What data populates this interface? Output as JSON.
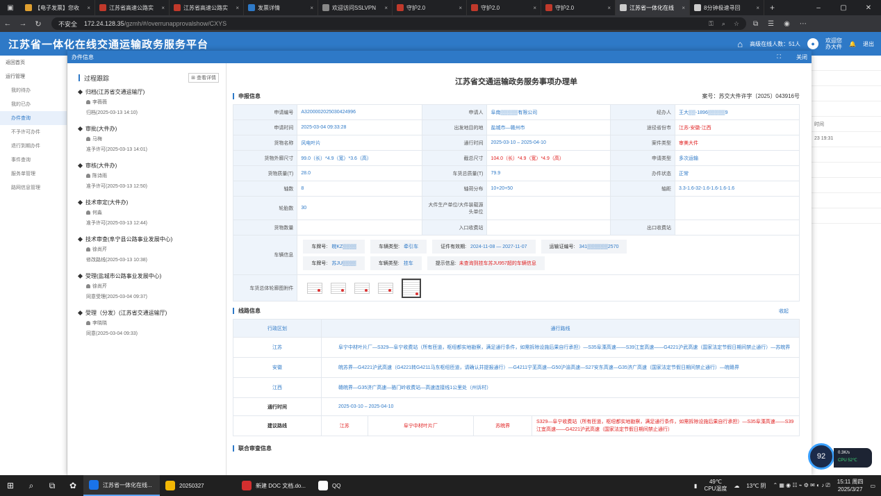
{
  "browser": {
    "tabs": [
      {
        "label": "【电子发票】您收",
        "color": "#e0a030"
      },
      {
        "label": "江苏省高速公路实",
        "color": "#c0392b"
      },
      {
        "label": "江苏省高速公路实",
        "color": "#c0392b"
      },
      {
        "label": "发票详情",
        "color": "#2e79c7"
      },
      {
        "label": "欢迎访问SSLVPN",
        "color": "#888888"
      },
      {
        "label": "守护2.0",
        "color": "#c0392b"
      },
      {
        "label": "守护2.0",
        "color": "#c0392b"
      },
      {
        "label": "守护2.0",
        "color": "#c0392b"
      },
      {
        "label": "江苏省一体化在线",
        "color": "#cccccc",
        "active": true
      },
      {
        "label": "8分钟极速寻回",
        "color": "#cccccc"
      }
    ],
    "insecure_label": "不安全",
    "url_host": "172.24.128.35",
    "url_path": "/gzmh/#/overrunapprovalshow/CXYS"
  },
  "app": {
    "title": "江苏省一体化在线交通运输政务服务平台",
    "online_users": "高级在线人数：51人",
    "welcome": "欢迎您",
    "username": "办大件",
    "logout": "退出"
  },
  "leftnav": [
    {
      "label": "返回首页",
      "sub": false
    },
    {
      "label": "运行管理",
      "sub": false
    },
    {
      "label": "我的待办",
      "sub": true
    },
    {
      "label": "我的已办",
      "sub": true
    },
    {
      "label": "办件查询",
      "sub": true,
      "selected": true
    },
    {
      "label": "不予许可办件",
      "sub": true
    },
    {
      "label": "退行到期办件",
      "sub": true
    },
    {
      "label": "事件查询",
      "sub": true
    },
    {
      "label": "服务单管理",
      "sub": true
    },
    {
      "label": "路网信息管理",
      "sub": true
    }
  ],
  "bg_right": [
    "",
    "",
    "",
    "",
    "时间",
    "23 19:31",
    "",
    "",
    "",
    "",
    ""
  ],
  "modal": {
    "title": "办件信息",
    "fullscreen": "⛶",
    "close": "关闭"
  },
  "track": {
    "title": "过程跟踪",
    "detail_btn": "查看详情",
    "steps": [
      {
        "title": "归档(江苏省交通运输厅)",
        "person": "李薇薇",
        "time": "归档(2025-03-13 14:10)"
      },
      {
        "title": "审批(大件办)",
        "person": "马梅",
        "time": "准予许可(2025-03-13 14:01)"
      },
      {
        "title": "审核(大件办)",
        "person": "陈诗雨",
        "time": "准予许可(2025-03-13 12:50)"
      },
      {
        "title": "技术审定(大件办)",
        "person": "何淼",
        "time": "准予许可(2025-03-13 12:44)"
      },
      {
        "title": "技术审查(阜宁县公路事业发展中心)",
        "person": "徐尚芹",
        "time": "修改路线(2025-03-13 10:38)"
      },
      {
        "title": "受理(盐城市公路事业发展中心)",
        "person": "徐尚芹",
        "time": "同意受理(2025-03-04 09:37)"
      },
      {
        "title": "受理（分发）(江苏省交通运输厅)",
        "person": "李晓晓",
        "time": "同意(2025-03-04 09:33)"
      }
    ]
  },
  "form": {
    "title": "江苏省交通运输政务服务事项办理单",
    "section1": "申报信息",
    "case_no": "案号：苏交大件许字〔2025〕043916号",
    "rows": [
      [
        [
          "申请编号",
          "A3200002025030424996",
          "v"
        ],
        [
          "申请人",
          "阜南▒▒▒▒▒有限公司",
          "v"
        ],
        [
          "经办人",
          "王大▒▒-1896▒▒▒▒▒9",
          "v"
        ]
      ],
      [
        [
          "申请时间",
          "2025-03-04 09:33:28",
          "v"
        ],
        [
          "出发地目的地",
          "盐城市—赣州市",
          "v"
        ],
        [
          "途径省份市",
          "江苏-安徽-江西",
          "red"
        ]
      ],
      [
        [
          "货物名称",
          "风电叶片",
          "v"
        ],
        [
          "通行时间",
          "2025-03-10 – 2025-04-10",
          "v"
        ],
        [
          "案件类型",
          "审美大件",
          "red"
        ]
      ],
      [
        [
          "货物外廓尺寸",
          "99.0（长）*4.9（宽）*3.6（高）",
          "v"
        ],
        [
          "截总尺寸",
          "104.0（长）*4.9（宽）*4.9（高）",
          "red"
        ],
        [
          "申请类型",
          "多次运输",
          "v"
        ]
      ],
      [
        [
          "货物质量(T)",
          "28.0",
          "v"
        ],
        [
          "车货总质量(T)",
          "79.9",
          "v"
        ],
        [
          "办件状态",
          "正常",
          "v"
        ]
      ],
      [
        [
          "轴数",
          "8",
          "v"
        ],
        [
          "轴荷分布",
          "10+20+50",
          "v"
        ],
        [
          "轴距",
          "3.3-1.6-32-1.6-1.6-1.6-1.6",
          "v"
        ]
      ],
      [
        [
          "轮胎数",
          "30",
          "v"
        ],
        [
          "大件生产单位/大件装载源头单位",
          "",
          "v"
        ],
        [
          "",
          "",
          "v"
        ]
      ],
      [
        [
          "货物数量",
          "",
          "v"
        ],
        [
          "入口收费站",
          "",
          "v"
        ],
        [
          "出口收费站",
          "",
          "v"
        ]
      ]
    ],
    "vehicle_label": "车辆信息",
    "vehicle_row1": [
      {
        "k": "车牌号:",
        "v": "皖KZ▒▒▒▒",
        "cls": "vv"
      },
      {
        "k": "车辆类型:",
        "v": "牵引车",
        "cls": "vv"
      },
      {
        "k": "证件有效期:",
        "v": "2024-11-08 — 2027-11-07",
        "cls": "vv"
      },
      {
        "k": "运输证编号:",
        "v": "341▒▒▒▒▒▒2570",
        "cls": "vv"
      }
    ],
    "vehicle_row2": [
      {
        "k": "车牌号:",
        "v": "苏JU▒▒▒▒",
        "cls": "vv"
      },
      {
        "k": "车辆类型:",
        "v": "挂车",
        "cls": "vv"
      },
      {
        "k": "提示信息:",
        "v": "未查询到挂车苏JU957超的车辆信息",
        "cls": "vr"
      }
    ],
    "attach_label": "车货总体轮廓图附件",
    "section2": "线路信息",
    "collapse": "收起",
    "route_head": [
      "行政区划",
      "通行路线"
    ],
    "routes": [
      {
        "region": "江苏",
        "route": "阜宁中材叶片厂—S329—阜宁收费站（所有匝道，枢纽都实地勘察，满足通行条件，如需拆除设施后果自行承担）—S35阜溧高速——S39江宜高速——G4221沪武高速（国家法定节假日期间禁止通行）—苏皖界"
      },
      {
        "region": "安徽",
        "route": "皖苏界—G4221沪武高速（G4221转G4211马东枢纽匝道，请确认并提报通行）—G4211宁芜高速—G50沪渝高速—S27安东高速—G35济广高速（国家法定节假日期间禁止通行）—皖赣界"
      },
      {
        "region": "江西",
        "route": "赣皖界—G35济广高速—骆门岭收费站—高速连接线1公里处（州诉村）"
      }
    ],
    "pass_time_label": "通行时间",
    "pass_time": "2025-03-10 – 2025-04-10",
    "suggest_label": "建议路线",
    "suggest_province": "江苏",
    "suggest_origin": "阜宁中材叶片厂",
    "suggest_border": "苏皖界",
    "suggest_route": "S329—阜宁收费站（所有匝道，枢纽都实地勘察，满足通行条件，如需拆除设施后果自行承担）—S35阜溧高速——S39江宜高速——G4221沪武高速（国家法定节假日期间禁止通行）",
    "section3": "联合审查信息"
  },
  "taskbar": {
    "apps": [
      {
        "label": "江苏省一体化在线...",
        "color": "#1a73e8",
        "active": true
      },
      {
        "label": "20250327",
        "color": "#f2b705"
      },
      {
        "label": "新建 DOC 文档.do...",
        "color": "#d32f2f"
      },
      {
        "label": "QQ",
        "color": "#ffffff"
      }
    ],
    "cpu_temp": "49℃",
    "cpu_temp_label": "CPU温度",
    "weather": "13℃ 阴",
    "time": "15:11 周四",
    "date": "2025/3/27"
  },
  "widget": {
    "gauge": "92",
    "net": "0.3K/s",
    "cpu": "CPU 52℃"
  }
}
